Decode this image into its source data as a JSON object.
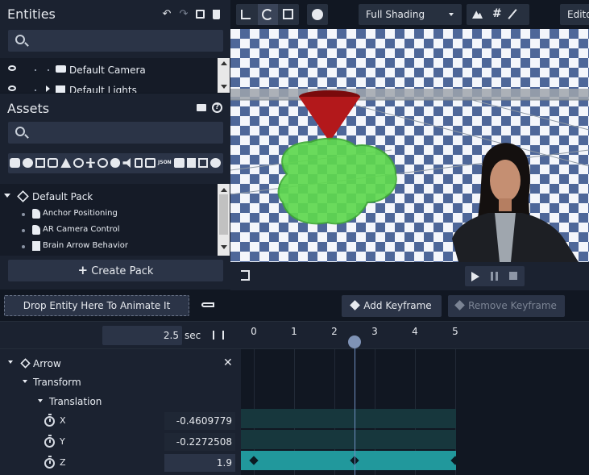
{
  "entities": {
    "title": "Entities",
    "items": [
      {
        "label": "Default Camera"
      },
      {
        "label": "Default Lights"
      }
    ]
  },
  "assets": {
    "title": "Assets",
    "pack": "Default Pack",
    "items": [
      {
        "label": "Anchor Positioning"
      },
      {
        "label": "AR Camera Control"
      },
      {
        "label": "Brain Arrow Behavior"
      }
    ],
    "create_pack": "Create Pack"
  },
  "viewport": {
    "shading": "Full Shading",
    "editor_tab": "Edito"
  },
  "timeline": {
    "drop_hint": "Drop Entity Here To Animate It",
    "add_keyframe": "Add Keyframe",
    "remove_keyframe": "Remove Keyframe",
    "time_value": "2.5",
    "time_unit": "sec",
    "ticks": [
      "0",
      "1",
      "2",
      "3",
      "4",
      "5"
    ],
    "tree": {
      "entity": "Arrow",
      "component": "Transform",
      "property": "Translation",
      "axes": [
        {
          "name": "X",
          "value": "-0.4609779"
        },
        {
          "name": "Y",
          "value": "-0.2272508"
        },
        {
          "name": "Z",
          "value": "1.9"
        }
      ]
    }
  },
  "colors": {
    "bg_dark": "#111722",
    "panel": "#1b2230",
    "input": "#2b3447",
    "track_teal": "#21989c",
    "track_dark": "#17373d",
    "cone_red": "#b3181b",
    "brain_green": "#5fd84f",
    "checker_blue": "#4e6799"
  },
  "icons": {
    "entities_header": [
      "undo-icon",
      "redo-icon",
      "duplicate-icon",
      "delete-icon"
    ],
    "assets_header": [
      "folder-icon",
      "help-icon"
    ],
    "viewport_toolbar": [
      "transform-axes-icon",
      "rotate-icon",
      "scale-icon",
      "globe-icon",
      "lighting-icon",
      "grid-icon",
      "magic-wand-icon"
    ],
    "playback": [
      "play-icon",
      "pause-icon",
      "stop-icon"
    ]
  }
}
